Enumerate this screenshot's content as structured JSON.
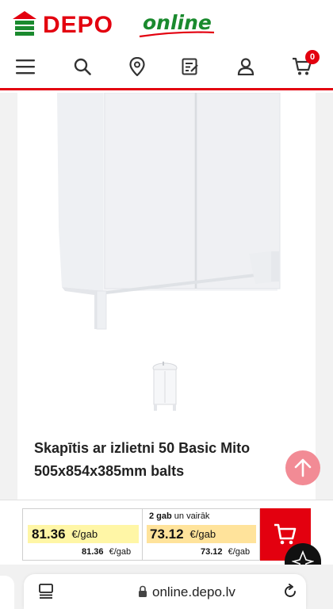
{
  "header": {
    "logo_depo": "DEPO",
    "logo_online": "online",
    "brand_red": "#e3000f",
    "brand_green": "#1a8a2e",
    "nav_icons": [
      "menu-icon",
      "search-icon",
      "location-pin-icon",
      "checklist-icon",
      "user-icon",
      "cart-icon"
    ],
    "cart_count": "0"
  },
  "product": {
    "title": "Skapītis ar izlietni 50 Basic Mito 505x854x385mm balts"
  },
  "price": {
    "single_value": "81.36",
    "single_unit": "€/gab",
    "single_small_value": "81.36",
    "single_small_unit": "€/gab",
    "tier_qty": "2 gab",
    "tier_more": "un vairāk",
    "tier_value": "73.12",
    "tier_unit": "€/gab",
    "tier_small_value": "73.12",
    "tier_small_unit": "€/gab"
  },
  "browser": {
    "url": "online.depo.lv"
  }
}
